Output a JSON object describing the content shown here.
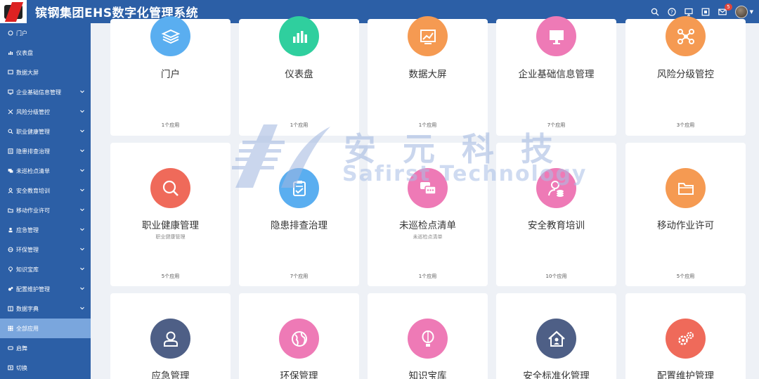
{
  "header": {
    "title": "镔钢集团EHS数字化管理系统",
    "notification_count": "5",
    "icons": [
      "search-icon",
      "help-icon",
      "monitor-icon",
      "fullscreen-icon",
      "mail-icon"
    ]
  },
  "sidebar": {
    "items": [
      {
        "label": "门户",
        "icon": "portal-icon"
      },
      {
        "label": "仪表盘",
        "icon": "chart-icon"
      },
      {
        "label": "数据大屏",
        "icon": "screen-icon"
      },
      {
        "label": "企业基础信息管理",
        "icon": "monitor-icon"
      },
      {
        "label": "风险分级管控",
        "icon": "nodes-icon"
      },
      {
        "label": "职业健康管理",
        "icon": "search-icon"
      },
      {
        "label": "隐患排查治理",
        "icon": "checklist-icon"
      },
      {
        "label": "未巡检点清单",
        "icon": "chat-icon"
      },
      {
        "label": "安全教育培训",
        "icon": "user-icon"
      },
      {
        "label": "移动作业许可",
        "icon": "folder-icon"
      },
      {
        "label": "应急管理",
        "icon": "person-icon"
      },
      {
        "label": "环保管理",
        "icon": "globe-icon"
      },
      {
        "label": "知识宝库",
        "icon": "bulb-icon"
      },
      {
        "label": "配置维护管理",
        "icon": "gears-icon"
      },
      {
        "label": "数据字典",
        "icon": "dictionary-icon"
      },
      {
        "label": "全部应用",
        "icon": "grid-icon"
      },
      {
        "label": "启舞",
        "icon": "rocket-icon"
      },
      {
        "label": "切换",
        "icon": "switch-icon"
      }
    ]
  },
  "watermark": {
    "cn": "安元科技",
    "en": "Safirst Technology"
  },
  "cards": [
    {
      "title": "门户",
      "sub": "",
      "count": "1个应用",
      "color": "#5aaef0",
      "icon": "layers-icon"
    },
    {
      "title": "仪表盘",
      "sub": "",
      "count": "1个应用",
      "color": "#2fcf9e",
      "icon": "bar-chart-icon"
    },
    {
      "title": "数据大屏",
      "sub": "",
      "count": "1个应用",
      "color": "#f59a52",
      "icon": "trend-chart-icon"
    },
    {
      "title": "企业基础信息管理",
      "sub": "",
      "count": "7个应用",
      "color": "#ee7ab6",
      "icon": "monitor-icon"
    },
    {
      "title": "风险分级管控",
      "sub": "",
      "count": "3个应用",
      "color": "#f59a52",
      "icon": "nodes-icon"
    },
    {
      "title": "职业健康管理",
      "sub": "职业健康管理",
      "count": "5个应用",
      "color": "#ef6a5a",
      "icon": "magnifier-icon"
    },
    {
      "title": "隐患排查治理",
      "sub": "",
      "count": "7个应用",
      "color": "#5aaef0",
      "icon": "clipboard-check-icon"
    },
    {
      "title": "未巡检点清单",
      "sub": "未巡检点清单",
      "count": "1个应用",
      "color": "#ee7ab6",
      "icon": "chat-bubbles-icon"
    },
    {
      "title": "安全教育培训",
      "sub": "",
      "count": "10个应用",
      "color": "#ee7ab6",
      "icon": "user-coins-icon"
    },
    {
      "title": "移动作业许可",
      "sub": "",
      "count": "5个应用",
      "color": "#f59a52",
      "icon": "folder-icon"
    },
    {
      "title": "应急管理",
      "sub": "",
      "count": "",
      "color": "#4e5f86",
      "icon": "person-icon"
    },
    {
      "title": "环保管理",
      "sub": "",
      "count": "",
      "color": "#ee7ab6",
      "icon": "globe-icon"
    },
    {
      "title": "知识宝库",
      "sub": "",
      "count": "",
      "color": "#ee7ab6",
      "icon": "balloon-icon"
    },
    {
      "title": "安全标准化管理",
      "sub": "",
      "count": "",
      "color": "#4e5f86",
      "icon": "house-user-icon"
    },
    {
      "title": "配置维护管理",
      "sub": "",
      "count": "",
      "color": "#ef6a5a",
      "icon": "gears-icon"
    }
  ]
}
